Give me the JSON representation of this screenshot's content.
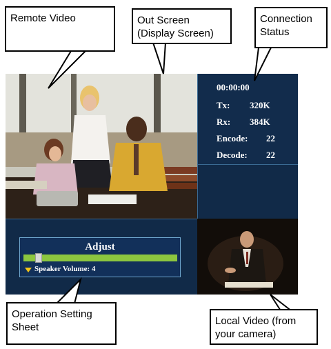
{
  "callouts": {
    "remote_video": "Remote Video",
    "out_screen": "Out Screen\n(Display Screen)",
    "connection_status": "Connection\nStatus",
    "operation_sheet": "Operation Setting\nSheet",
    "local_video": "Local Video (from\nyour camera)"
  },
  "status": {
    "time": "00:00:00",
    "tx_label": "Tx:",
    "tx_value": "320K",
    "rx_label": "Rx:",
    "rx_value": "384K",
    "encode_label": "Encode:",
    "encode_value": "22",
    "decode_label": "Decode:",
    "decode_value": "22"
  },
  "adjust": {
    "title": "Adjust",
    "volume_label": "Speaker Volume: 4",
    "volume_level": 0.1
  },
  "colors": {
    "screen_bg": "#122c4c",
    "slider": "#8cc63f",
    "arrow": "#f2c418"
  }
}
